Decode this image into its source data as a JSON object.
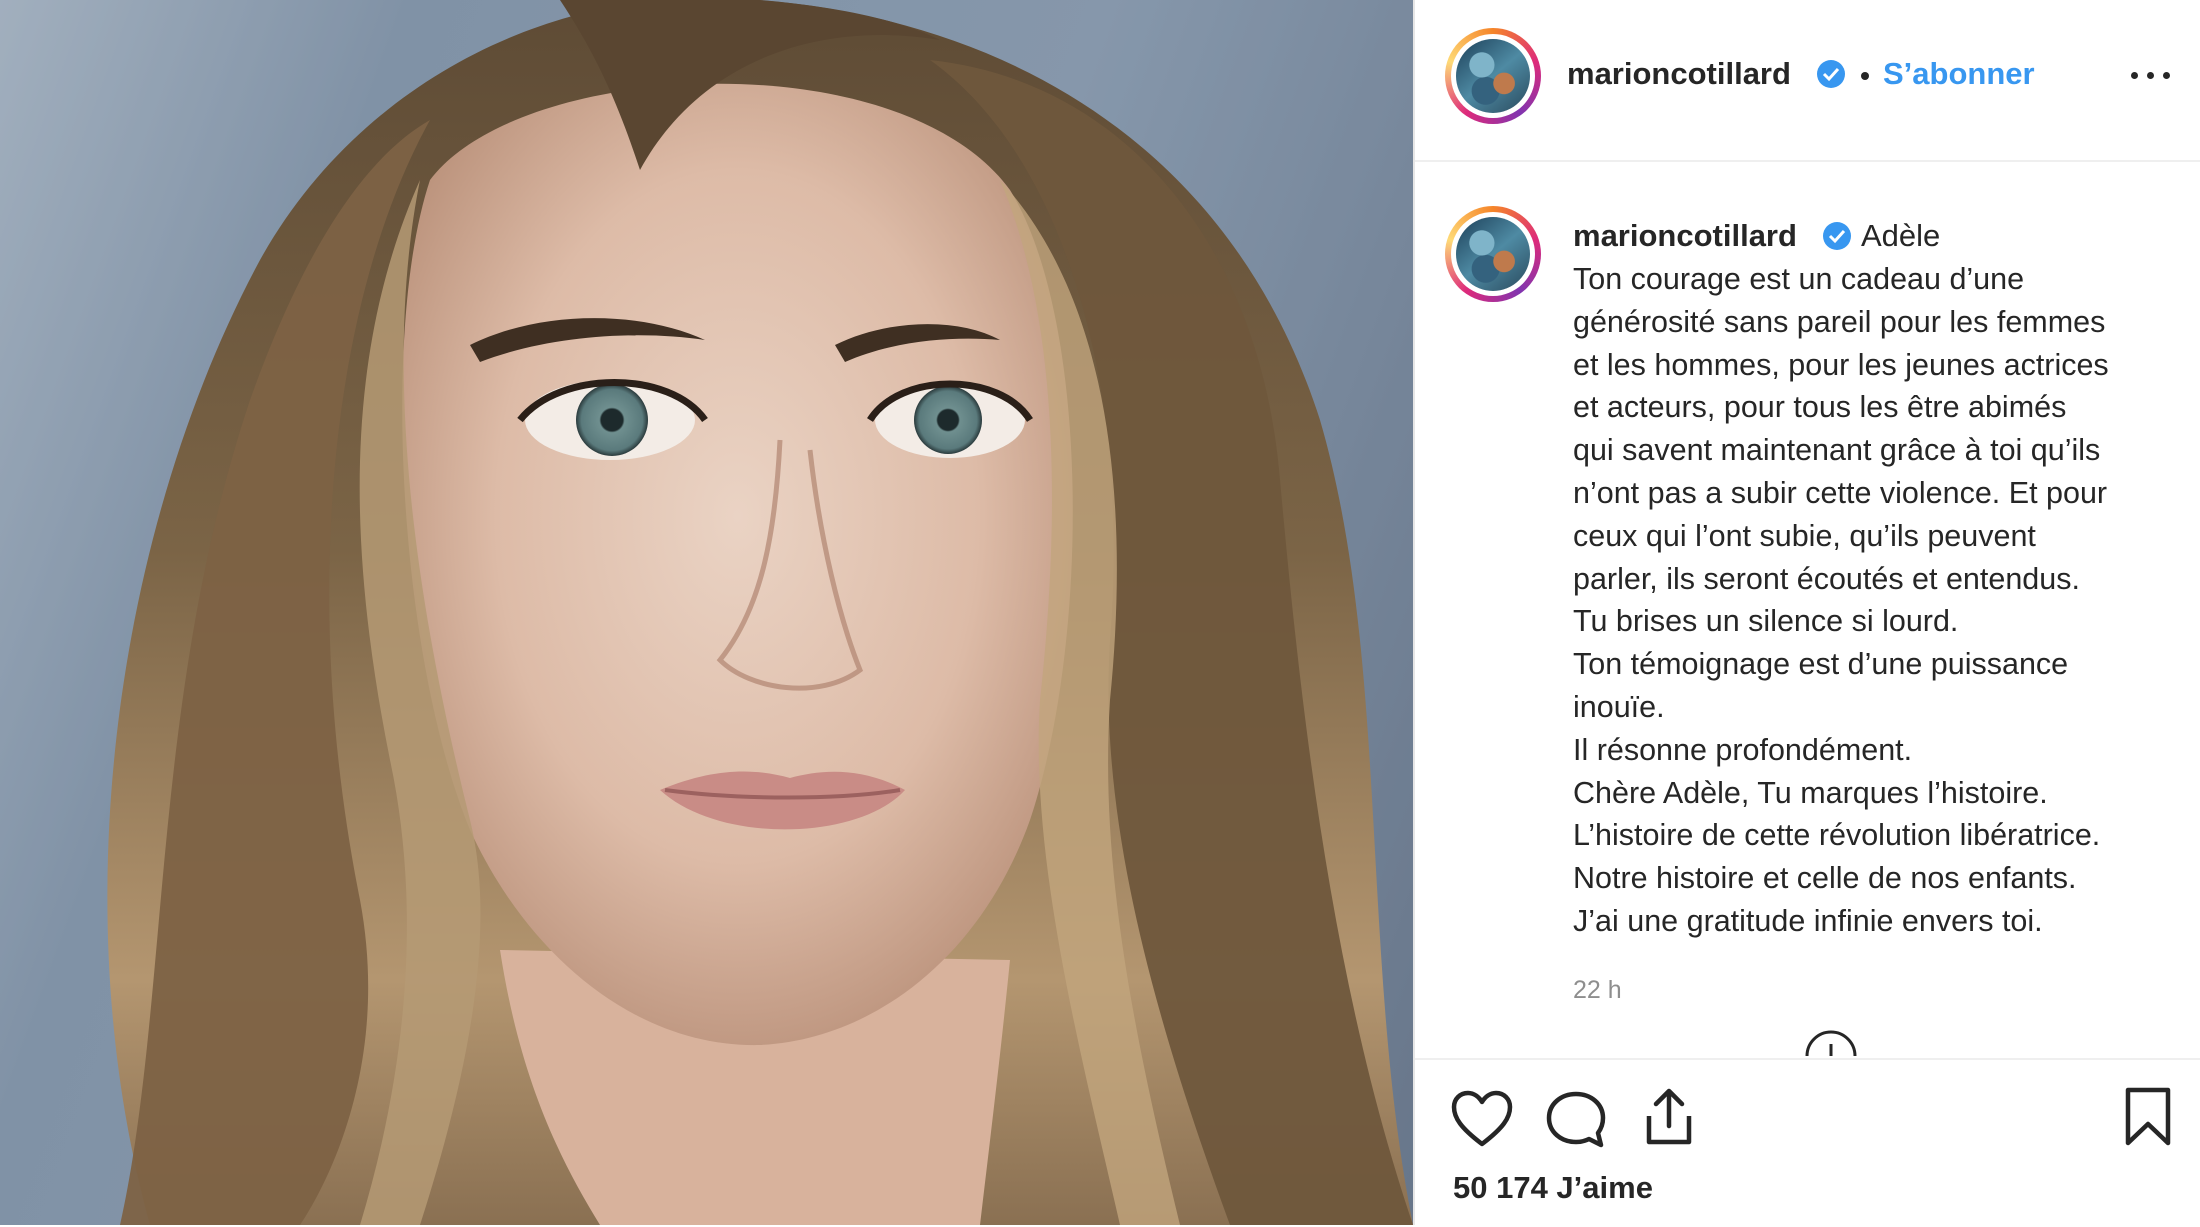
{
  "post": {
    "username": "marioncotillard",
    "follow_label": "S’abonner",
    "caption_first_line": "Adèle",
    "caption_lines": [
      "Ton courage est un cadeau d’une",
      "générosité sans pareil pour les femmes",
      "et les hommes, pour les jeunes actrices",
      "et acteurs, pour tous les être abimés",
      "qui savent maintenant grâce à toi qu’ils",
      "n’ont pas a subir cette violence. Et pour",
      "ceux qui l’ont subie, qu’ils peuvent",
      "parler, ils seront écoutés et entendus.",
      "Tu brises un silence si lourd.",
      "Ton témoignage est d’une puissance",
      "inouïe.",
      "Il résonne profondément.",
      "Chère Adèle, Tu marques l’histoire.",
      "L’histoire de cette révolution libératrice.",
      "Notre histoire et celle de nos enfants.",
      "J’ai une gratitude infinie envers toi."
    ],
    "time_ago": "22 h",
    "likes_label": "50 174 J’aime"
  },
  "icons": {
    "verified": "verified-badge-icon",
    "more": "more-options-icon",
    "like": "heart-icon",
    "comment": "comment-icon",
    "share": "share-icon",
    "save": "bookmark-icon",
    "load_more": "load-more-comments-icon"
  },
  "colors": {
    "accent_blue": "#3897f0",
    "text": "#262626",
    "muted": "#8e8e8e",
    "border": "#efefef"
  }
}
